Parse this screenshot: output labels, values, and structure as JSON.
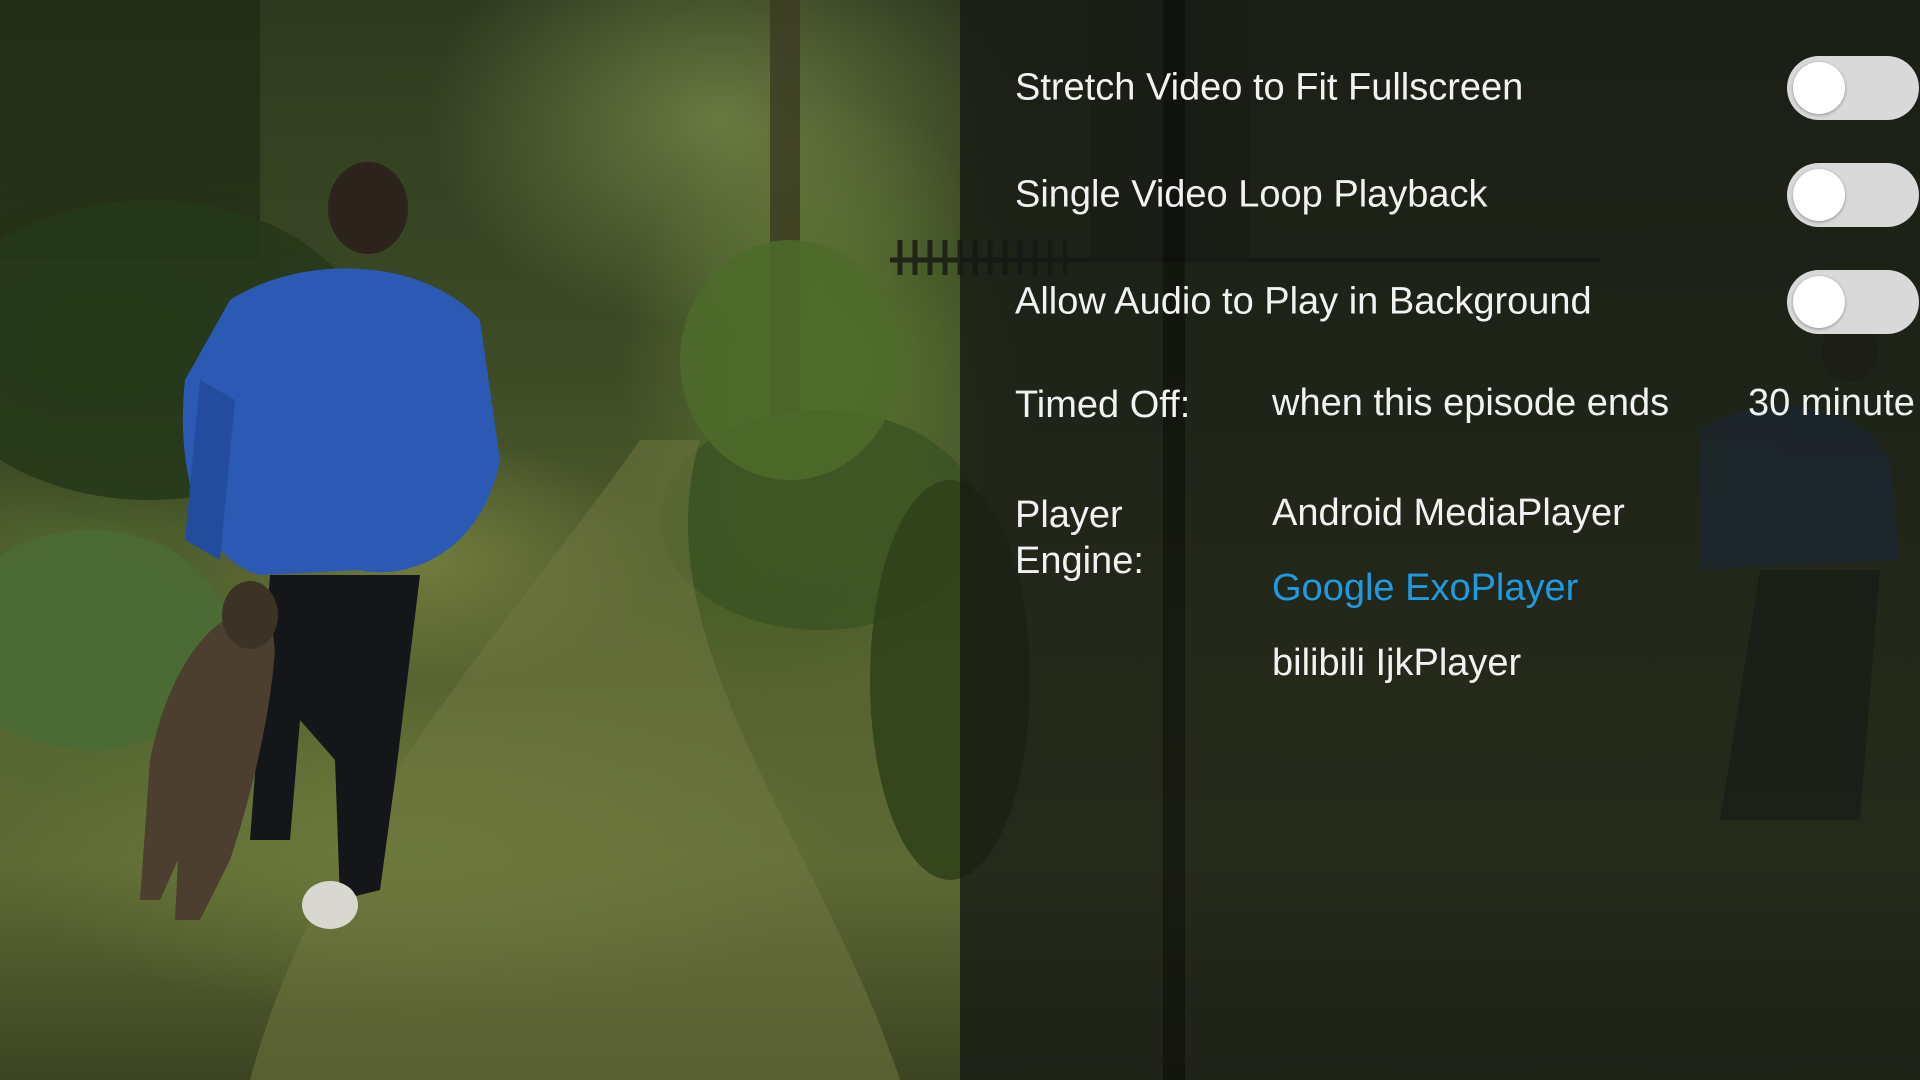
{
  "settings": {
    "stretch_video": {
      "label": "Stretch Video to Fit Fullscreen",
      "enabled": false
    },
    "loop_playback": {
      "label": "Single Video Loop Playback",
      "enabled": false
    },
    "background_audio": {
      "label": "Allow Audio to Play in Background",
      "enabled": false
    },
    "timed_off": {
      "label": "Timed Off:",
      "options": [
        "when this episode ends",
        "30 minute"
      ]
    },
    "player_engine": {
      "label": "Player Engine:",
      "options": [
        "Android MediaPlayer",
        "Google ExoPlayer",
        "bilibili IjkPlayer"
      ],
      "selected": "Google ExoPlayer"
    }
  },
  "colors": {
    "accent": "#1e9be0",
    "text": "#f2f2f2",
    "switch_track": "#d9d9d9",
    "panel_overlay": "#161814"
  }
}
